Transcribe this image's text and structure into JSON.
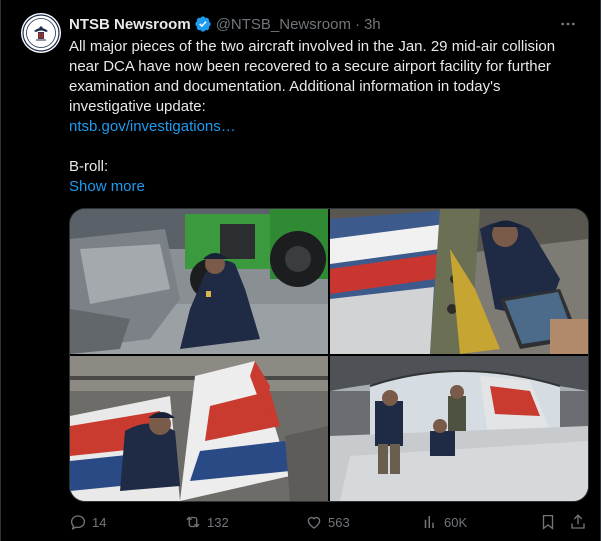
{
  "author": {
    "display_name": "NTSB Newsroom",
    "handle": "@NTSB_Newsroom",
    "separator": "·",
    "time": "3h"
  },
  "tweet": {
    "text": "All major pieces of the two aircraft involved in the Jan. 29 mid-air collision near DCA have now been recovered to a secure airport facility for further examination and documentation. Additional information in today's investigative update:",
    "link": "ntsb.gov/investigations…",
    "broll": "B-roll:",
    "show_more": "Show more"
  },
  "media": {
    "count": 4
  },
  "metrics": {
    "replies": "14",
    "reposts": "132",
    "likes": "563",
    "views": "60K"
  },
  "colors": {
    "background": "#000000",
    "text": "#e7e9ea",
    "muted": "#71767b",
    "accent": "#1d9bf0"
  },
  "icons": [
    "ntsb-seal-icon",
    "verified-icon",
    "more-icon",
    "reply-icon",
    "repost-icon",
    "like-icon",
    "views-icon",
    "bookmark-icon",
    "share-icon"
  ]
}
